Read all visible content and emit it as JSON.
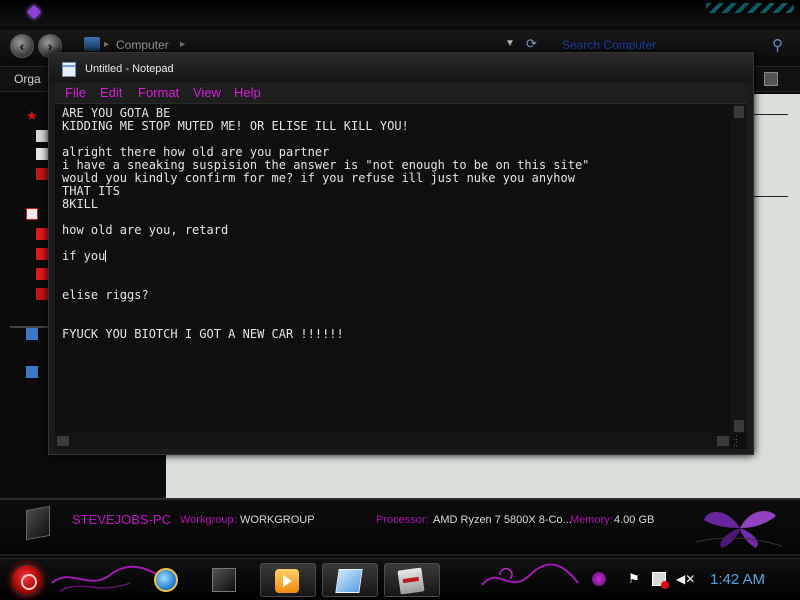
{
  "explorer": {
    "address": "Computer",
    "search_placeholder": "Search Computer",
    "organize_label": "Orga"
  },
  "details": {
    "computer_name": "STEVEJOBS-PC",
    "workgroup_label": "Workgroup:",
    "workgroup_value": "WORKGROUP",
    "processor_label": "Processor:",
    "processor_value": "AMD Ryzen 7 5800X 8-Co...",
    "memory_label": "Memory:",
    "memory_value": "4.00 GB"
  },
  "notepad": {
    "title": "Untitled - Notepad",
    "menu": [
      "File",
      "Edit",
      "Format",
      "View",
      "Help"
    ],
    "lines_before_caret": "ARE YOU GOTA BE\nKIDDING ME STOP MUTED ME! OR ELISE ILL KILL YOU!\n\nalright there how old are you partner\ni have a sneaking suspision the answer is \"not enough to be on this site\"\nwould you kindly confirm for me? if you refuse ill just nuke you anyhow\nTHAT ITS\n8KILL\n\nhow old are you, retard\n\nif you",
    "lines_after_caret": "\n\n\nelise riggs?\n\n\nFYUCK YOU BIOTCH I GOT A NEW CAR !!!!!!"
  },
  "taskbar": {
    "clock": "1:42 AM",
    "pinned": [
      "internet-explorer",
      "dark-app",
      "media-player",
      "notepad",
      "typing-app"
    ]
  },
  "colors": {
    "menu_accent": "#d321d8",
    "clock": "#4aa7e6",
    "search_text": "#1e3fa8"
  }
}
